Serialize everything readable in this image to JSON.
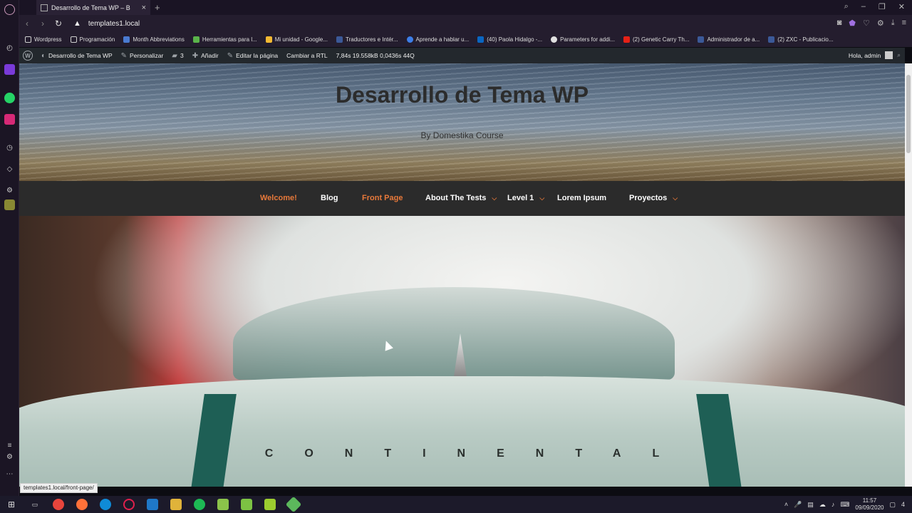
{
  "browser": {
    "tab_title": "Desarrollo de Tema WP – B",
    "tab_close": "×",
    "new_tab": "+",
    "url": "templates1.local",
    "warn_icon": "▲",
    "status_url": "templates1.local/front-page/"
  },
  "bookmarks": [
    {
      "label": "Wordpress",
      "icon": "folder-icon",
      "color": "#cfcfcf"
    },
    {
      "label": "Programación",
      "icon": "folder-icon",
      "color": "#cfcfcf"
    },
    {
      "label": "Month Abbreviations",
      "icon": "site-icon",
      "color": "#4a7bd1"
    },
    {
      "label": "Herramientas para l...",
      "icon": "site-icon",
      "color": "#5ab34a"
    },
    {
      "label": "Mi unidad - Google...",
      "icon": "drive-icon",
      "color": "#f2b933"
    },
    {
      "label": "Traductores e Intér...",
      "icon": "facebook-icon",
      "color": "#3b5998"
    },
    {
      "label": "Aprende a hablar u...",
      "icon": "site-icon",
      "color": "#3c7ee8"
    },
    {
      "label": "(40) Paola Hidalgo -...",
      "icon": "linkedin-icon",
      "color": "#0a66c2"
    },
    {
      "label": "Parameters for addi...",
      "icon": "github-icon",
      "color": "#e0e0e0"
    },
    {
      "label": "(2) Genetic Carry Th...",
      "icon": "youtube-icon",
      "color": "#e62117"
    },
    {
      "label": "Administrador de a...",
      "icon": "facebook-icon",
      "color": "#3b5998"
    },
    {
      "label": "(2) ZXC - Publicacio...",
      "icon": "facebook-icon",
      "color": "#3b5998"
    }
  ],
  "wpbar": {
    "site_name": "Desarrollo de Tema WP",
    "customize": "Personalizar",
    "comments": "3",
    "add_new": "Añadir",
    "edit_page": "Editar la página",
    "rtl": "Cambiar a RTL",
    "stats": "7,84s   19.558kB   0,0436s   44Q",
    "greeting": "Hola, admin"
  },
  "site": {
    "title": "Desarrollo de Tema WP",
    "tagline": "By Domestika Course",
    "badge_text": "CONTINENTAL"
  },
  "nav": [
    {
      "label": "Welcome!",
      "color": "#e8793a",
      "dropdown": false
    },
    {
      "label": "Blog",
      "color": "#ffffff",
      "dropdown": false
    },
    {
      "label": "Front Page",
      "color": "#e8793a",
      "dropdown": false
    },
    {
      "label": "About The Tests",
      "color": "#ffffff",
      "dropdown": true
    },
    {
      "label": "Level 1",
      "color": "#ffffff",
      "dropdown": true
    },
    {
      "label": "Lorem Ipsum",
      "color": "#ffffff",
      "dropdown": false
    },
    {
      "label": "Proyectos",
      "color": "#ffffff",
      "dropdown": true
    }
  ],
  "taskbar": {
    "time": "11:57",
    "date": "09/09/2020",
    "notifications": "4"
  }
}
